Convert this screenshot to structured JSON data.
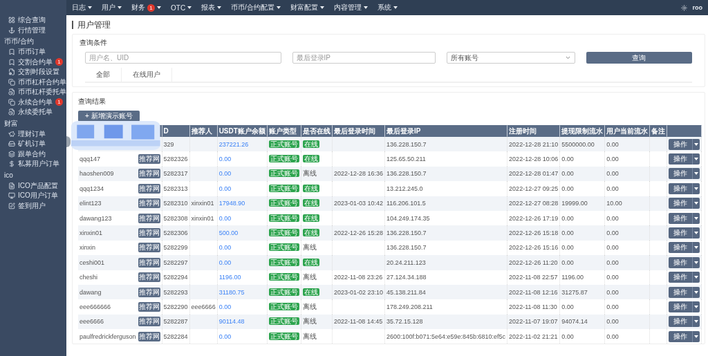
{
  "top_nav": {
    "items": [
      {
        "label": "日志"
      },
      {
        "label": "用户"
      },
      {
        "label": "财务",
        "badge": "1"
      },
      {
        "label": "OTC"
      },
      {
        "label": "报表"
      },
      {
        "label": "币币/合约配置"
      },
      {
        "label": "财富配置"
      },
      {
        "label": "内容管理"
      },
      {
        "label": "系统"
      }
    ],
    "user": "roo"
  },
  "sidebar": {
    "sections": [
      {
        "items": [
          {
            "label": "综合查询"
          },
          {
            "label": "行情管理"
          }
        ]
      },
      {
        "title": "币币/合约",
        "items": [
          {
            "label": "币币订单"
          },
          {
            "label": "交割合约单",
            "badge": "1"
          },
          {
            "label": "交割时段设置"
          },
          {
            "label": "币币杠杆合约单"
          },
          {
            "label": "币币杠杆委托单"
          },
          {
            "label": "永续合约单",
            "badge": "1"
          },
          {
            "label": "永续委托单"
          }
        ]
      },
      {
        "title": "财富",
        "items": [
          {
            "label": "理财订单"
          },
          {
            "label": "矿机订单"
          },
          {
            "label": "跟单合约"
          },
          {
            "label": "私募用户订单"
          }
        ]
      },
      {
        "title": "ico",
        "items": [
          {
            "label": "ICO产品配置"
          },
          {
            "label": "ICO用户订单"
          },
          {
            "label": "签到用户"
          }
        ]
      }
    ]
  },
  "page_title": "用户管理",
  "query": {
    "title": "查询条件",
    "user_field": {
      "placeholder": "用户名、UID"
    },
    "ip_field": {
      "placeholder": "最后登录IP"
    },
    "account_select": {
      "value": "所有账号"
    },
    "button": "查询",
    "tabs": [
      {
        "label": "全部",
        "selected": false
      },
      {
        "label": "在线用户",
        "selected": false
      }
    ]
  },
  "results": {
    "title": "查询结果",
    "add_button": "+ 新增演示账号",
    "columns": [
      {},
      {
        "label": "D"
      },
      {
        "label": "推荐人"
      },
      {
        "label": "USDT账户余额"
      },
      {
        "label": "账户类型"
      },
      {
        "label": "是否在线"
      },
      {
        "label": "最后登录时间"
      },
      {
        "label": "最后登录IP"
      },
      {
        "label": "注册时间"
      },
      {
        "label": "提现限制流水"
      },
      {
        "label": "用户当前流水"
      },
      {
        "label": "备注"
      },
      {}
    ],
    "rows": [
      {
        "uid": "329",
        "balance": "237221.26",
        "type": "正式账号",
        "online": true,
        "status": "在线",
        "ip": "136.228.150.7",
        "registered": "2022-12-28 21:10",
        "limit": "5500000.00",
        "current": "0.00",
        "action": "操作"
      },
      {
        "name": "qqq147",
        "tag": "推荐网",
        "uid": "5282326",
        "balance": "0.00",
        "type": "正式账号",
        "online": true,
        "status": "在线",
        "ip": "125.65.50.211",
        "registered": "2022-12-28 10:06",
        "limit": "0.00",
        "current": "0.00",
        "action": "操作"
      },
      {
        "name": "haoshen009",
        "tag": "推荐网",
        "uid": "5282317",
        "balance": "0.00",
        "type": "正式账号",
        "online": false,
        "status": "离线",
        "last_login": "2022-12-28 16:36",
        "ip": "136.228.150.7",
        "registered": "2022-12-28 01:47",
        "limit": "0.00",
        "current": "0.00",
        "action": "操作"
      },
      {
        "name": "qqq1234",
        "tag": "推荐网",
        "uid": "5282313",
        "balance": "0.00",
        "type": "正式账号",
        "online": true,
        "status": "在线",
        "ip": "13.212.245.0",
        "registered": "2022-12-27 09:25",
        "limit": "0.00",
        "current": "0.00",
        "action": "操作"
      },
      {
        "name": "elint123",
        "tag": "推荐网",
        "uid": "5282310",
        "referrer": "xinxin01",
        "balance": "17948.90",
        "type": "正式账号",
        "online": true,
        "status": "在线",
        "last_login": "2023-01-03 10:42",
        "ip": "116.206.101.5",
        "registered": "2022-12-27 08:28",
        "limit": "19999.00",
        "current": "10.00",
        "action": "操作"
      },
      {
        "name": "dawang123",
        "tag": "推荐网",
        "uid": "5282308",
        "referrer": "xinxin01",
        "balance": "0.00",
        "type": "正式账号",
        "online": true,
        "status": "在线",
        "ip": "104.249.174.35",
        "registered": "2022-12-26 17:19",
        "limit": "0.00",
        "current": "0.00",
        "action": "操作"
      },
      {
        "name": "xinxin01",
        "tag": "推荐网",
        "uid": "5282306",
        "balance": "500.00",
        "type": "正式账号",
        "online": true,
        "status": "在线",
        "last_login": "2022-12-26 15:28",
        "ip": "136.228.150.7",
        "registered": "2022-12-26 15:18",
        "limit": "0.00",
        "current": "0.00",
        "action": "操作"
      },
      {
        "name": "xinxin",
        "tag": "推荐网",
        "uid": "5282299",
        "balance": "0.00",
        "type": "正式账号",
        "online": false,
        "status": "离线",
        "ip": "136.228.150.7",
        "registered": "2022-12-26 15:16",
        "limit": "0.00",
        "current": "0.00",
        "action": "操作"
      },
      {
        "name": "ceshi001",
        "tag": "推荐网",
        "uid": "5282297",
        "balance": "0.00",
        "type": "正式账号",
        "online": true,
        "status": "在线",
        "ip": "20.24.211.123",
        "registered": "2022-12-26 11:20",
        "limit": "0.00",
        "current": "0.00",
        "action": "操作"
      },
      {
        "name": "cheshi",
        "tag": "推荐网",
        "uid": "5282294",
        "balance": "1196.00",
        "type": "正式账号",
        "online": false,
        "status": "离线",
        "last_login": "2022-11-08 23:26",
        "ip": "27.124.34.188",
        "registered": "2022-11-08 22:57",
        "limit": "1196.00",
        "current": "0.00",
        "action": "操作"
      },
      {
        "name": "dawang",
        "tag": "推荐网",
        "uid": "5282293",
        "balance": "31180.75",
        "type": "正式账号",
        "online": true,
        "status": "在线",
        "last_login": "2023-01-02 23:10",
        "ip": "45.138.211.84",
        "registered": "2022-11-08 12:16",
        "limit": "31275.87",
        "current": "0.00",
        "action": "操作"
      },
      {
        "name": "eee666666",
        "tag": "推荐网",
        "uid": "5282290",
        "referrer": "eee6666",
        "balance": "0.00",
        "type": "正式账号",
        "online": false,
        "status": "离线",
        "ip": "178.249.208.211",
        "registered": "2022-11-08 11:30",
        "limit": "0.00",
        "current": "0.00",
        "action": "操作"
      },
      {
        "name": "eee6666",
        "tag": "推荐网",
        "uid": "5282287",
        "balance": "90114.48",
        "type": "正式账号",
        "online": false,
        "status": "离线",
        "last_login": "2022-11-08 14:45",
        "ip": "35.72.15.128",
        "registered": "2022-11-07 19:07",
        "limit": "94074.14",
        "current": "0.00",
        "action": "操作"
      },
      {
        "name": "paulfredrickferguson",
        "tag": "推荐网",
        "uid": "5282284",
        "balance": "0.00",
        "type": "正式账号",
        "online": false,
        "status": "离线",
        "ip": "2600:100f:b071:5e64:e59e:845b:6810:ef5c",
        "registered": "2022-11-02 21:21",
        "limit": "0.00",
        "current": "0.00",
        "action": "操作"
      }
    ]
  }
}
